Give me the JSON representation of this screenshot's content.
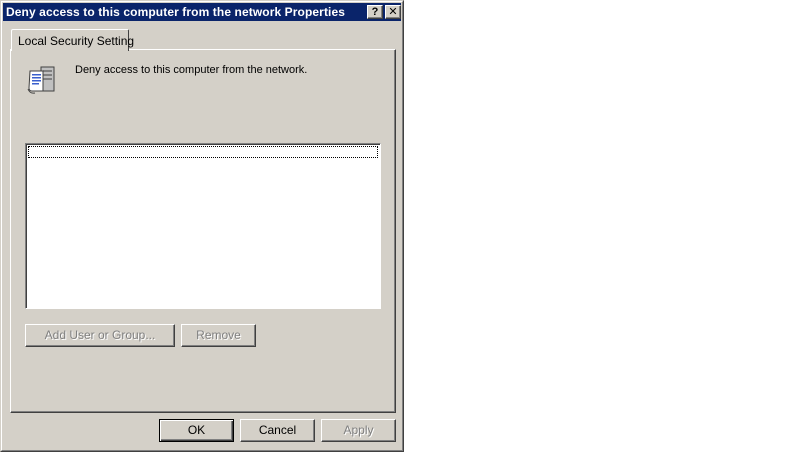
{
  "window": {
    "title": "Deny access to this computer from the network Properties",
    "help_label": "?",
    "close_label": "✕"
  },
  "tabs": [
    {
      "label": "Local Security Setting",
      "active": true
    }
  ],
  "policy": {
    "icon": "policy-document-icon",
    "name": "Deny access to this computer from the network."
  },
  "list": {
    "items": []
  },
  "buttons": {
    "add_user_or_group": "Add User or Group...",
    "remove": "Remove",
    "ok": "OK",
    "cancel": "Cancel",
    "apply": "Apply"
  },
  "colors": {
    "titlebar": "#0a246a",
    "face": "#d4d0c8",
    "disabled_text": "#808080"
  }
}
